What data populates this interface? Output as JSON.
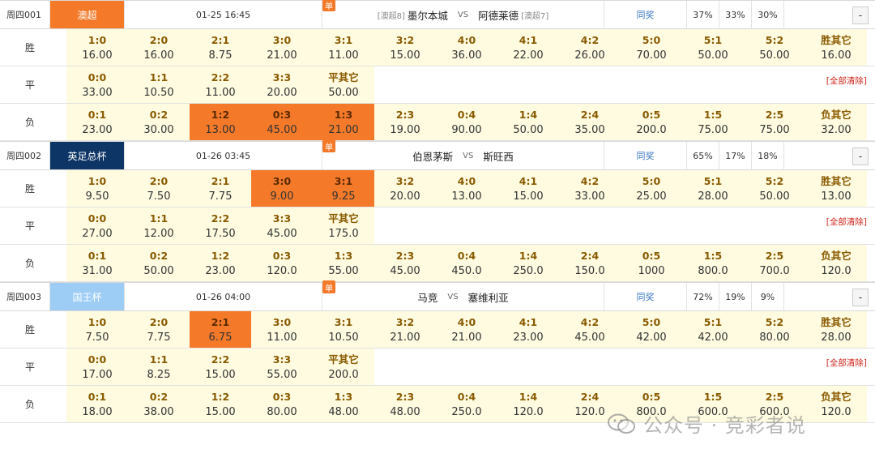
{
  "matches": [
    {
      "code": "周四001",
      "league": "澳超",
      "league_color": "#f47a2a",
      "time": "01-25 16:45",
      "dan": "单",
      "home_rank": "[澳超8]",
      "home": "墨尔本城",
      "vs": "VS",
      "away": "阿德莱德",
      "away_rank": "[澳超7]",
      "tongjiang": "同奖",
      "pct": [
        "37%",
        "33%",
        "30%"
      ],
      "dash": "-",
      "win_label": "胜",
      "draw_label": "平",
      "lose_label": "负",
      "clear": "[全部清除]",
      "win": [
        [
          "1:0",
          "16.00",
          false
        ],
        [
          "2:0",
          "16.00",
          false
        ],
        [
          "2:1",
          "8.75",
          false
        ],
        [
          "3:0",
          "21.00",
          false
        ],
        [
          "3:1",
          "11.00",
          false
        ],
        [
          "3:2",
          "15.00",
          false
        ],
        [
          "4:0",
          "36.00",
          false
        ],
        [
          "4:1",
          "22.00",
          false
        ],
        [
          "4:2",
          "26.00",
          false
        ],
        [
          "5:0",
          "70.00",
          false
        ],
        [
          "5:1",
          "50.00",
          false
        ],
        [
          "5:2",
          "50.00",
          false
        ],
        [
          "胜其它",
          "16.00",
          false
        ]
      ],
      "draw": [
        [
          "0:0",
          "33.00",
          false
        ],
        [
          "1:1",
          "10.50",
          false
        ],
        [
          "2:2",
          "11.00",
          false
        ],
        [
          "3:3",
          "20.00",
          false
        ],
        [
          "平其它",
          "50.00",
          false
        ]
      ],
      "lose": [
        [
          "0:1",
          "23.00",
          false
        ],
        [
          "0:2",
          "30.00",
          false
        ],
        [
          "1:2",
          "13.00",
          true
        ],
        [
          "0:3",
          "45.00",
          true
        ],
        [
          "1:3",
          "21.00",
          true
        ],
        [
          "2:3",
          "19.00",
          false
        ],
        [
          "0:4",
          "90.00",
          false
        ],
        [
          "1:4",
          "50.00",
          false
        ],
        [
          "2:4",
          "35.00",
          false
        ],
        [
          "0:5",
          "200.0",
          false
        ],
        [
          "1:5",
          "75.00",
          false
        ],
        [
          "2:5",
          "75.00",
          false
        ],
        [
          "负其它",
          "32.00",
          false
        ]
      ]
    },
    {
      "code": "周四002",
      "league": "英足总杯",
      "league_color": "#0d3566",
      "time": "01-26 03:45",
      "dan": "单",
      "home_rank": "",
      "home": "伯恩茅斯",
      "vs": "VS",
      "away": "斯旺西",
      "away_rank": "",
      "tongjiang": "同奖",
      "pct": [
        "65%",
        "17%",
        "18%"
      ],
      "dash": "-",
      "win_label": "胜",
      "draw_label": "平",
      "lose_label": "负",
      "clear": "[全部清除]",
      "win": [
        [
          "1:0",
          "9.50",
          false
        ],
        [
          "2:0",
          "7.50",
          false
        ],
        [
          "2:1",
          "7.75",
          false
        ],
        [
          "3:0",
          "9.00",
          true
        ],
        [
          "3:1",
          "9.25",
          true
        ],
        [
          "3:2",
          "20.00",
          false
        ],
        [
          "4:0",
          "13.00",
          false
        ],
        [
          "4:1",
          "15.00",
          false
        ],
        [
          "4:2",
          "33.00",
          false
        ],
        [
          "5:0",
          "25.00",
          false
        ],
        [
          "5:1",
          "28.00",
          false
        ],
        [
          "5:2",
          "50.00",
          false
        ],
        [
          "胜其它",
          "13.00",
          false
        ]
      ],
      "draw": [
        [
          "0:0",
          "27.00",
          false
        ],
        [
          "1:1",
          "12.00",
          false
        ],
        [
          "2:2",
          "17.50",
          false
        ],
        [
          "3:3",
          "45.00",
          false
        ],
        [
          "平其它",
          "175.0",
          false
        ]
      ],
      "lose": [
        [
          "0:1",
          "31.00",
          false
        ],
        [
          "0:2",
          "50.00",
          false
        ],
        [
          "1:2",
          "23.00",
          false
        ],
        [
          "0:3",
          "120.0",
          false
        ],
        [
          "1:3",
          "55.00",
          false
        ],
        [
          "2:3",
          "45.00",
          false
        ],
        [
          "0:4",
          "450.0",
          false
        ],
        [
          "1:4",
          "250.0",
          false
        ],
        [
          "2:4",
          "150.0",
          false
        ],
        [
          "0:5",
          "1000",
          false
        ],
        [
          "1:5",
          "800.0",
          false
        ],
        [
          "2:5",
          "700.0",
          false
        ],
        [
          "负其它",
          "120.0",
          false
        ]
      ]
    },
    {
      "code": "周四003",
      "league": "国王杯",
      "league_color": "#9dcdf5",
      "time": "01-26 04:00",
      "dan": "单",
      "home_rank": "",
      "home": "马竞",
      "vs": "VS",
      "away": "塞维利亚",
      "away_rank": "",
      "tongjiang": "同奖",
      "pct": [
        "72%",
        "19%",
        "9%"
      ],
      "dash": "-",
      "win_label": "胜",
      "draw_label": "平",
      "lose_label": "负",
      "clear": "[全部清除]",
      "win": [
        [
          "1:0",
          "7.50",
          false
        ],
        [
          "2:0",
          "7.75",
          false
        ],
        [
          "2:1",
          "6.75",
          true
        ],
        [
          "3:0",
          "11.00",
          false
        ],
        [
          "3:1",
          "10.50",
          false
        ],
        [
          "3:2",
          "21.00",
          false
        ],
        [
          "4:0",
          "21.00",
          false
        ],
        [
          "4:1",
          "23.00",
          false
        ],
        [
          "4:2",
          "45.00",
          false
        ],
        [
          "5:0",
          "42.00",
          false
        ],
        [
          "5:1",
          "42.00",
          false
        ],
        [
          "5:2",
          "80.00",
          false
        ],
        [
          "胜其它",
          "28.00",
          false
        ]
      ],
      "draw": [
        [
          "0:0",
          "17.00",
          false
        ],
        [
          "1:1",
          "8.25",
          false
        ],
        [
          "2:2",
          "15.00",
          false
        ],
        [
          "3:3",
          "55.00",
          false
        ],
        [
          "平其它",
          "200.0",
          false
        ]
      ],
      "lose": [
        [
          "0:1",
          "18.00",
          false
        ],
        [
          "0:2",
          "38.00",
          false
        ],
        [
          "1:2",
          "15.00",
          false
        ],
        [
          "0:3",
          "80.00",
          false
        ],
        [
          "1:3",
          "48.00",
          false
        ],
        [
          "2:3",
          "48.00",
          false
        ],
        [
          "0:4",
          "250.0",
          false
        ],
        [
          "1:4",
          "120.0",
          false
        ],
        [
          "2:4",
          "120.0",
          false
        ],
        [
          "0:5",
          "800.0",
          false
        ],
        [
          "1:5",
          "600.0",
          false
        ],
        [
          "2:5",
          "600.0",
          false
        ],
        [
          "负其它",
          "120.0",
          false
        ]
      ]
    }
  ],
  "watermark": "公众号 · 竞彩者说"
}
